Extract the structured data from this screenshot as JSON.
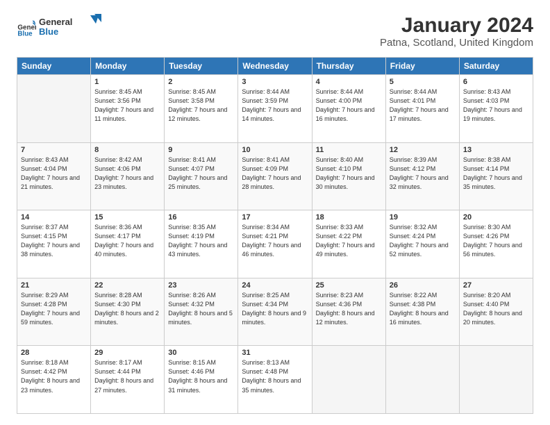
{
  "logo": {
    "general": "General",
    "blue": "Blue"
  },
  "title": "January 2024",
  "subtitle": "Patna, Scotland, United Kingdom",
  "days": [
    "Sunday",
    "Monday",
    "Tuesday",
    "Wednesday",
    "Thursday",
    "Friday",
    "Saturday"
  ],
  "weeks": [
    [
      {
        "num": "",
        "empty": true
      },
      {
        "num": "1",
        "sunrise": "8:45 AM",
        "sunset": "3:56 PM",
        "daylight": "7 hours and 11 minutes."
      },
      {
        "num": "2",
        "sunrise": "8:45 AM",
        "sunset": "3:58 PM",
        "daylight": "7 hours and 12 minutes."
      },
      {
        "num": "3",
        "sunrise": "8:44 AM",
        "sunset": "3:59 PM",
        "daylight": "7 hours and 14 minutes."
      },
      {
        "num": "4",
        "sunrise": "8:44 AM",
        "sunset": "4:00 PM",
        "daylight": "7 hours and 16 minutes."
      },
      {
        "num": "5",
        "sunrise": "8:44 AM",
        "sunset": "4:01 PM",
        "daylight": "7 hours and 17 minutes."
      },
      {
        "num": "6",
        "sunrise": "8:43 AM",
        "sunset": "4:03 PM",
        "daylight": "7 hours and 19 minutes."
      }
    ],
    [
      {
        "num": "7",
        "sunrise": "8:43 AM",
        "sunset": "4:04 PM",
        "daylight": "7 hours and 21 minutes."
      },
      {
        "num": "8",
        "sunrise": "8:42 AM",
        "sunset": "4:06 PM",
        "daylight": "7 hours and 23 minutes."
      },
      {
        "num": "9",
        "sunrise": "8:41 AM",
        "sunset": "4:07 PM",
        "daylight": "7 hours and 25 minutes."
      },
      {
        "num": "10",
        "sunrise": "8:41 AM",
        "sunset": "4:09 PM",
        "daylight": "7 hours and 28 minutes."
      },
      {
        "num": "11",
        "sunrise": "8:40 AM",
        "sunset": "4:10 PM",
        "daylight": "7 hours and 30 minutes."
      },
      {
        "num": "12",
        "sunrise": "8:39 AM",
        "sunset": "4:12 PM",
        "daylight": "7 hours and 32 minutes."
      },
      {
        "num": "13",
        "sunrise": "8:38 AM",
        "sunset": "4:14 PM",
        "daylight": "7 hours and 35 minutes."
      }
    ],
    [
      {
        "num": "14",
        "sunrise": "8:37 AM",
        "sunset": "4:15 PM",
        "daylight": "7 hours and 38 minutes."
      },
      {
        "num": "15",
        "sunrise": "8:36 AM",
        "sunset": "4:17 PM",
        "daylight": "7 hours and 40 minutes."
      },
      {
        "num": "16",
        "sunrise": "8:35 AM",
        "sunset": "4:19 PM",
        "daylight": "7 hours and 43 minutes."
      },
      {
        "num": "17",
        "sunrise": "8:34 AM",
        "sunset": "4:21 PM",
        "daylight": "7 hours and 46 minutes."
      },
      {
        "num": "18",
        "sunrise": "8:33 AM",
        "sunset": "4:22 PM",
        "daylight": "7 hours and 49 minutes."
      },
      {
        "num": "19",
        "sunrise": "8:32 AM",
        "sunset": "4:24 PM",
        "daylight": "7 hours and 52 minutes."
      },
      {
        "num": "20",
        "sunrise": "8:30 AM",
        "sunset": "4:26 PM",
        "daylight": "7 hours and 56 minutes."
      }
    ],
    [
      {
        "num": "21",
        "sunrise": "8:29 AM",
        "sunset": "4:28 PM",
        "daylight": "7 hours and 59 minutes."
      },
      {
        "num": "22",
        "sunrise": "8:28 AM",
        "sunset": "4:30 PM",
        "daylight": "8 hours and 2 minutes."
      },
      {
        "num": "23",
        "sunrise": "8:26 AM",
        "sunset": "4:32 PM",
        "daylight": "8 hours and 5 minutes."
      },
      {
        "num": "24",
        "sunrise": "8:25 AM",
        "sunset": "4:34 PM",
        "daylight": "8 hours and 9 minutes."
      },
      {
        "num": "25",
        "sunrise": "8:23 AM",
        "sunset": "4:36 PM",
        "daylight": "8 hours and 12 minutes."
      },
      {
        "num": "26",
        "sunrise": "8:22 AM",
        "sunset": "4:38 PM",
        "daylight": "8 hours and 16 minutes."
      },
      {
        "num": "27",
        "sunrise": "8:20 AM",
        "sunset": "4:40 PM",
        "daylight": "8 hours and 20 minutes."
      }
    ],
    [
      {
        "num": "28",
        "sunrise": "8:18 AM",
        "sunset": "4:42 PM",
        "daylight": "8 hours and 23 minutes."
      },
      {
        "num": "29",
        "sunrise": "8:17 AM",
        "sunset": "4:44 PM",
        "daylight": "8 hours and 27 minutes."
      },
      {
        "num": "30",
        "sunrise": "8:15 AM",
        "sunset": "4:46 PM",
        "daylight": "8 hours and 31 minutes."
      },
      {
        "num": "31",
        "sunrise": "8:13 AM",
        "sunset": "4:48 PM",
        "daylight": "8 hours and 35 minutes."
      },
      {
        "num": "",
        "empty": true
      },
      {
        "num": "",
        "empty": true
      },
      {
        "num": "",
        "empty": true
      }
    ]
  ]
}
